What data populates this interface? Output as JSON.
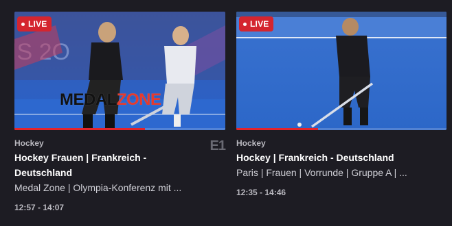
{
  "cards": [
    {
      "live_label": "LIVE",
      "overlay": {
        "part1": "MEDAL",
        "part2": "ZONE"
      },
      "progress": 0.62,
      "sport": "Hockey",
      "title": "Hockey Frauen | Frankreich - Deutschland",
      "subtitle": "Medal Zone | Olympia-Konferenz mit ...",
      "time": "12:57 - 14:07",
      "channel_logo": "E1"
    },
    {
      "live_label": "LIVE",
      "progress": 0.39,
      "sport": "Hockey",
      "title": "Hockey | Frankreich - Deutschland",
      "subtitle": "Paris | Frauen | Vorrunde | Gruppe A | ...",
      "time": "12:35 - 14:46"
    }
  ],
  "colors": {
    "background": "#1d1c23",
    "live_badge": "#d4252f",
    "progress": "#e3242b",
    "pitch": "#2f6fd1"
  },
  "icons": [
    "live-dot-icon",
    "eurosport-1-logo-icon"
  ]
}
